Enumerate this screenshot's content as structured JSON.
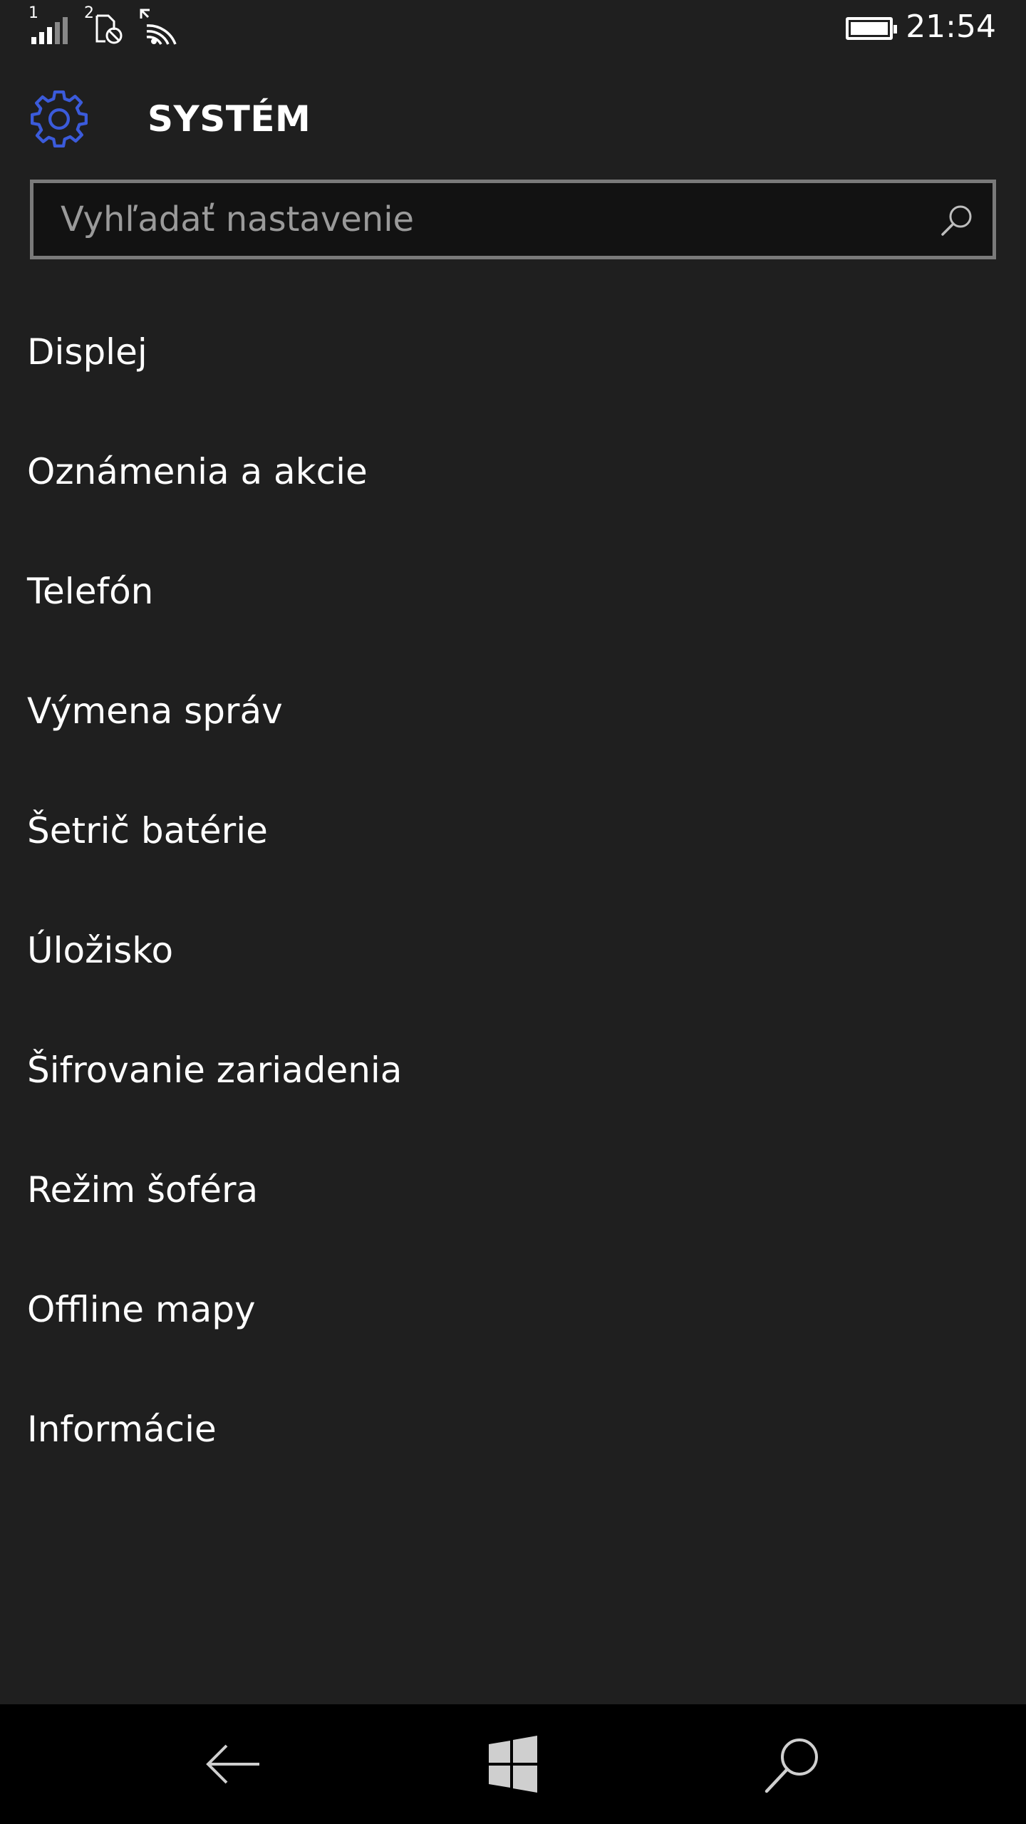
{
  "status_bar": {
    "sim1_label": "1",
    "sim2_label": "2",
    "time": "21:54",
    "battery_level": 1.0,
    "icons": [
      "signal-bars-icon",
      "sim-no-service-icon",
      "wifi-icon",
      "battery-icon"
    ]
  },
  "header": {
    "title": "SYSTÉM",
    "icon": "gear-icon",
    "accent_color": "#3b5bdb"
  },
  "search": {
    "placeholder": "Vyhľadať nastavenie",
    "value": ""
  },
  "menu": {
    "items": [
      {
        "label": "Displej"
      },
      {
        "label": "Oznámenia a akcie"
      },
      {
        "label": "Telefón"
      },
      {
        "label": "Výmena správ"
      },
      {
        "label": "Šetrič batérie"
      },
      {
        "label": "Úložisko"
      },
      {
        "label": "Šifrovanie zariadenia"
      },
      {
        "label": "Režim šoféra"
      },
      {
        "label": "Offline mapy"
      },
      {
        "label": "Informácie"
      }
    ]
  },
  "nav_bar": {
    "buttons": [
      "back-arrow-icon",
      "windows-start-icon",
      "search-icon"
    ]
  },
  "colors": {
    "background": "#1f1f1f",
    "nav_background": "#000000",
    "text": "#ffffff",
    "placeholder": "#9a9a9a",
    "search_border": "#7a7a7a"
  }
}
